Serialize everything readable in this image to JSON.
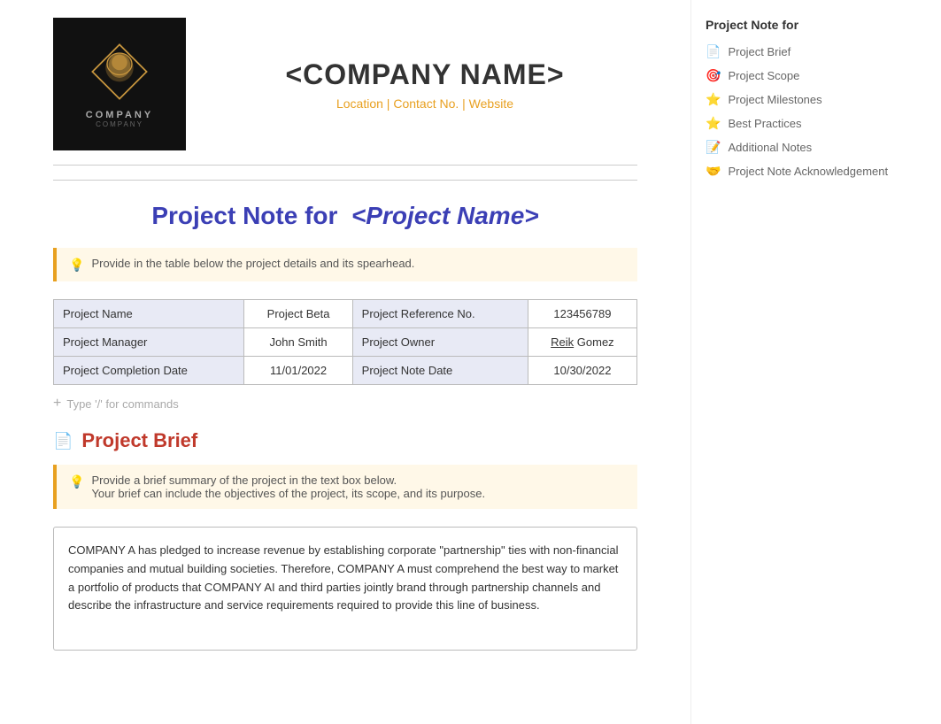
{
  "header": {
    "company_name": "<COMPANY NAME>",
    "company_contact": "Location | Contact No. | Website",
    "logo_text": "COMPANY",
    "logo_subtext": "COMPANY"
  },
  "project_title": {
    "static_part": "Project Note for",
    "dynamic_part": "<Project Name>"
  },
  "info_box_1": {
    "text": "Provide in the table below the project details and its spearhead."
  },
  "project_table": {
    "rows": [
      [
        "Project Name",
        "Project Beta",
        "Project Reference No.",
        "123456789"
      ],
      [
        "Project Manager",
        "John Smith",
        "Project Owner",
        "Reik Gomez"
      ],
      [
        "Project Completion Date",
        "11/01/2022",
        "Project Note Date",
        "10/30/2022"
      ]
    ]
  },
  "command_hint": {
    "plus": "+",
    "text": "Type '/' for commands"
  },
  "project_brief": {
    "heading": "Project Brief",
    "info_line1": "Provide a brief summary of the project in the text box below.",
    "info_line2": "Your brief can include the objectives of the project, its scope, and its purpose.",
    "body": "COMPANY A has pledged to increase revenue by establishing corporate \"partnership\" ties with non-financial companies and mutual building societies. Therefore, COMPANY A must comprehend the best way to market a portfolio of products that COMPANY AI and third parties jointly brand through partnership channels and describe the infrastructure and service requirements required to provide this line of business."
  },
  "sidebar": {
    "title": "Project Note for",
    "items": [
      {
        "icon": "📄",
        "label": "Project Brief"
      },
      {
        "icon": "🎯",
        "label": "Project Scope"
      },
      {
        "icon": "⭐",
        "label": "Project Milestones"
      },
      {
        "icon": "⭐",
        "label": "Best Practices"
      },
      {
        "icon": "📝",
        "label": "Additional Notes"
      },
      {
        "icon": "🤝",
        "label": "Project Note Acknowledgement"
      }
    ]
  }
}
